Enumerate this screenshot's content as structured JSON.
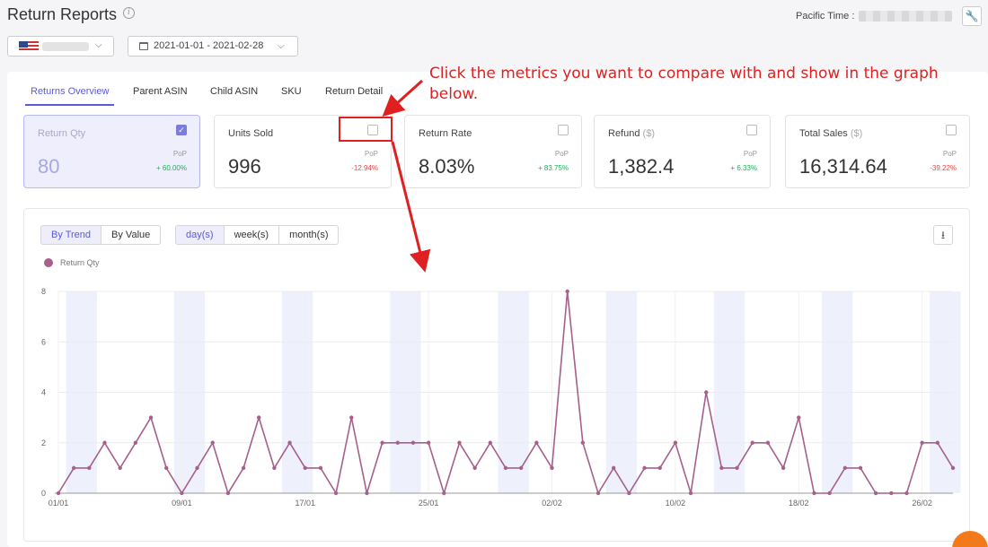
{
  "header": {
    "title": "Return Reports",
    "info_icon": "i",
    "pacific_label": "Pacific Time :",
    "settings_icon": "wrench-icon"
  },
  "filters": {
    "country_flag": "us-flag-icon",
    "date_range": "2021-01-01 - 2021-02-28"
  },
  "tabs": [
    {
      "label": "Returns Overview",
      "active": true
    },
    {
      "label": "Parent ASIN",
      "active": false
    },
    {
      "label": "Child ASIN",
      "active": false
    },
    {
      "label": "SKU",
      "active": false
    },
    {
      "label": "Return Detail",
      "active": false
    }
  ],
  "cards": [
    {
      "label": "Return Qty",
      "unit": "",
      "value": "80",
      "pop": "PoP",
      "change": "+ 60.00%",
      "change_color": "#1fae5b",
      "checked": true,
      "active": true
    },
    {
      "label": "Units Sold",
      "unit": "",
      "value": "996",
      "pop": "PoP",
      "change": "-12.94%",
      "change_color": "#e24a4a",
      "checked": false,
      "active": false
    },
    {
      "label": "Return Rate",
      "unit": "",
      "value": "8.03%",
      "pop": "PoP",
      "change": "+ 83.75%",
      "change_color": "#1fae5b",
      "checked": false,
      "active": false
    },
    {
      "label": "Refund",
      "unit": "($)",
      "value": "1,382.4",
      "pop": "PoP",
      "change": "+ 6.33%",
      "change_color": "#1fae5b",
      "checked": false,
      "active": false
    },
    {
      "label": "Total Sales",
      "unit": "($)",
      "value": "16,314.64",
      "pop": "PoP",
      "change": "-39.22%",
      "change_color": "#e24a4a",
      "checked": false,
      "active": false
    }
  ],
  "annotation": {
    "line1": "Click the metrics you want to compare with and show in the graph",
    "line2": "below."
  },
  "chart_controls": {
    "view_modes": [
      {
        "label": "By Trend",
        "active": true
      },
      {
        "label": "By Value",
        "active": false
      }
    ],
    "granularity": [
      {
        "label": "day(s)",
        "active": true
      },
      {
        "label": "week(s)",
        "active": false
      },
      {
        "label": "month(s)",
        "active": false
      }
    ],
    "download_icon": "download-icon"
  },
  "chart_data": {
    "type": "line",
    "legend": [
      "Return Qty"
    ],
    "series_color": "#a5608c",
    "ylim": [
      0,
      8
    ],
    "yticks": [
      0,
      2,
      4,
      6,
      8
    ],
    "xtick_labels": [
      "01/01",
      "09/01",
      "17/01",
      "25/01",
      "02/02",
      "10/02",
      "18/02",
      "26/02"
    ],
    "xtick_indices": [
      0,
      8,
      16,
      24,
      32,
      40,
      48,
      56
    ],
    "series": [
      {
        "name": "Return Qty",
        "values": [
          0,
          1,
          1,
          2,
          1,
          2,
          3,
          1,
          0,
          1,
          2,
          0,
          1,
          3,
          1,
          2,
          1,
          1,
          0,
          3,
          0,
          2,
          2,
          2,
          2,
          0,
          2,
          1,
          2,
          1,
          1,
          2,
          1,
          8,
          2,
          0,
          1,
          0,
          1,
          1,
          2,
          0,
          4,
          1,
          1,
          2,
          2,
          1,
          3,
          0,
          0,
          1,
          1,
          0,
          0,
          0,
          2,
          2,
          1
        ]
      }
    ],
    "grid": true
  }
}
